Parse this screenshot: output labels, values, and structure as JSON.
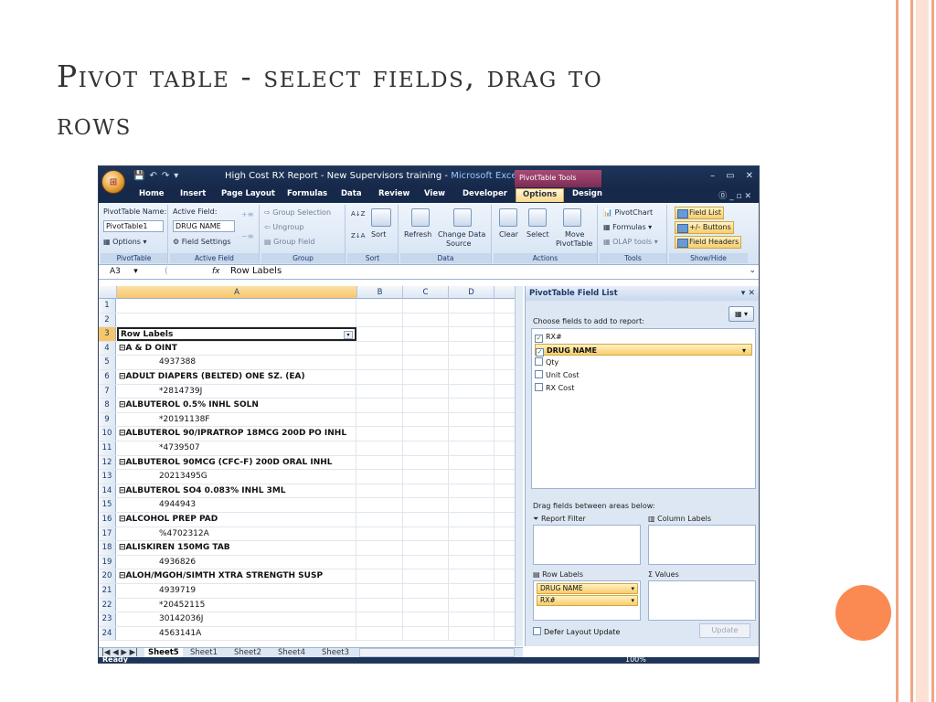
{
  "slide": {
    "title_line1": "Pivot table - select fields, drag to",
    "title_line2": "rows"
  },
  "excel": {
    "window_title": "High Cost RX Report - New Supervisors training - ",
    "window_title_app": "Microsoft Excel",
    "contextual_tab_group": "PivotTable Tools",
    "tabs": [
      "Home",
      "Insert",
      "Page Layout",
      "Formulas",
      "Data",
      "Review",
      "View",
      "Developer",
      "Options",
      "Design"
    ],
    "active_tab": "Options",
    "ribbon": {
      "pivottable_name_label": "PivotTable Name:",
      "pivottable_name_value": "PivotTable1",
      "options_label": "Options",
      "active_field_label": "Active Field:",
      "active_field_value": "DRUG NAME",
      "field_settings_label": "Field Settings",
      "group_selection_label": "Group Selection",
      "ungroup_label": "Ungroup",
      "group_field_label": "Group Field",
      "sort_label": "Sort",
      "refresh_label": "Refresh",
      "change_data_label_1": "Change Data",
      "change_data_label_2": "Source",
      "clear_label": "Clear",
      "select_label": "Select",
      "move_label_1": "Move",
      "move_label_2": "PivotTable",
      "pivotchart_label": "PivotChart",
      "formulas_label": "Formulas",
      "olap_label": "OLAP tools",
      "field_list_label": "Field List",
      "buttons_label": "+/- Buttons",
      "field_headers_label": "Field Headers",
      "groups": [
        "PivotTable",
        "Active Field",
        "Group",
        "Sort",
        "Data",
        "Actions",
        "Tools",
        "Show/Hide"
      ]
    },
    "formula_bar": {
      "name_box": "A3",
      "fx": "fx",
      "formula": "Row Labels"
    },
    "columns": [
      "A",
      "B",
      "C",
      "D"
    ],
    "rows": [
      {
        "n": "1",
        "a": "",
        "kind": "empty"
      },
      {
        "n": "2",
        "a": "",
        "kind": "empty"
      },
      {
        "n": "3",
        "a": "Row Labels",
        "kind": "header"
      },
      {
        "n": "4",
        "a": "⊟A & D OINT",
        "kind": "group"
      },
      {
        "n": "5",
        "a": "4937388",
        "kind": "item"
      },
      {
        "n": "6",
        "a": "⊟ADULT DIAPERS (BELTED) ONE SZ. (EA)",
        "kind": "group"
      },
      {
        "n": "7",
        "a": "*2814739J",
        "kind": "item"
      },
      {
        "n": "8",
        "a": "⊟ALBUTEROL 0.5% INHL SOLN",
        "kind": "group"
      },
      {
        "n": "9",
        "a": "*20191138F",
        "kind": "item"
      },
      {
        "n": "10",
        "a": "⊟ALBUTEROL 90/IPRATROP 18MCG 200D PO INHL",
        "kind": "group"
      },
      {
        "n": "11",
        "a": "*4739507",
        "kind": "item"
      },
      {
        "n": "12",
        "a": "⊟ALBUTEROL 90MCG (CFC-F) 200D ORAL INHL",
        "kind": "group"
      },
      {
        "n": "13",
        "a": "20213495G",
        "kind": "item"
      },
      {
        "n": "14",
        "a": "⊟ALBUTEROL SO4 0.083% INHL 3ML",
        "kind": "group"
      },
      {
        "n": "15",
        "a": "4944943",
        "kind": "item"
      },
      {
        "n": "16",
        "a": "⊟ALCOHOL PREP PAD",
        "kind": "group"
      },
      {
        "n": "17",
        "a": "%4702312A",
        "kind": "item"
      },
      {
        "n": "18",
        "a": "⊟ALISKIREN 150MG TAB",
        "kind": "group"
      },
      {
        "n": "19",
        "a": "4936826",
        "kind": "item"
      },
      {
        "n": "20",
        "a": "⊟ALOH/MGOH/SIMTH XTRA STRENGTH SUSP",
        "kind": "group"
      },
      {
        "n": "21",
        "a": "4939719",
        "kind": "item"
      },
      {
        "n": "22",
        "a": "*20452115",
        "kind": "item"
      },
      {
        "n": "23",
        "a": "30142036J",
        "kind": "item"
      },
      {
        "n": "24",
        "a": "4563141A",
        "kind": "item"
      }
    ],
    "sheet_tabs": [
      "Sheet5",
      "Sheet1",
      "Sheet2",
      "Sheet4",
      "Sheet3"
    ],
    "active_sheet": "Sheet5",
    "status": "Ready",
    "zoom": "100%",
    "field_list": {
      "title": "PivotTable Field List",
      "choose_label": "Choose fields to add to report:",
      "fields": [
        {
          "name": "RX#",
          "checked": true,
          "highlight": false
        },
        {
          "name": "DRUG NAME",
          "checked": true,
          "highlight": true
        },
        {
          "name": "Qty",
          "checked": false,
          "highlight": false
        },
        {
          "name": "Unit Cost",
          "checked": false,
          "highlight": false
        },
        {
          "name": "RX Cost",
          "checked": false,
          "highlight": false
        }
      ],
      "drag_label": "Drag fields between areas below:",
      "report_filter_label": "Report Filter",
      "column_labels_label": "Column Labels",
      "row_labels_label": "Row Labels",
      "values_label": "Values",
      "row_label_items": [
        "DRUG NAME",
        "RX#"
      ],
      "defer_label": "Defer Layout Update",
      "update_label": "Update"
    }
  }
}
